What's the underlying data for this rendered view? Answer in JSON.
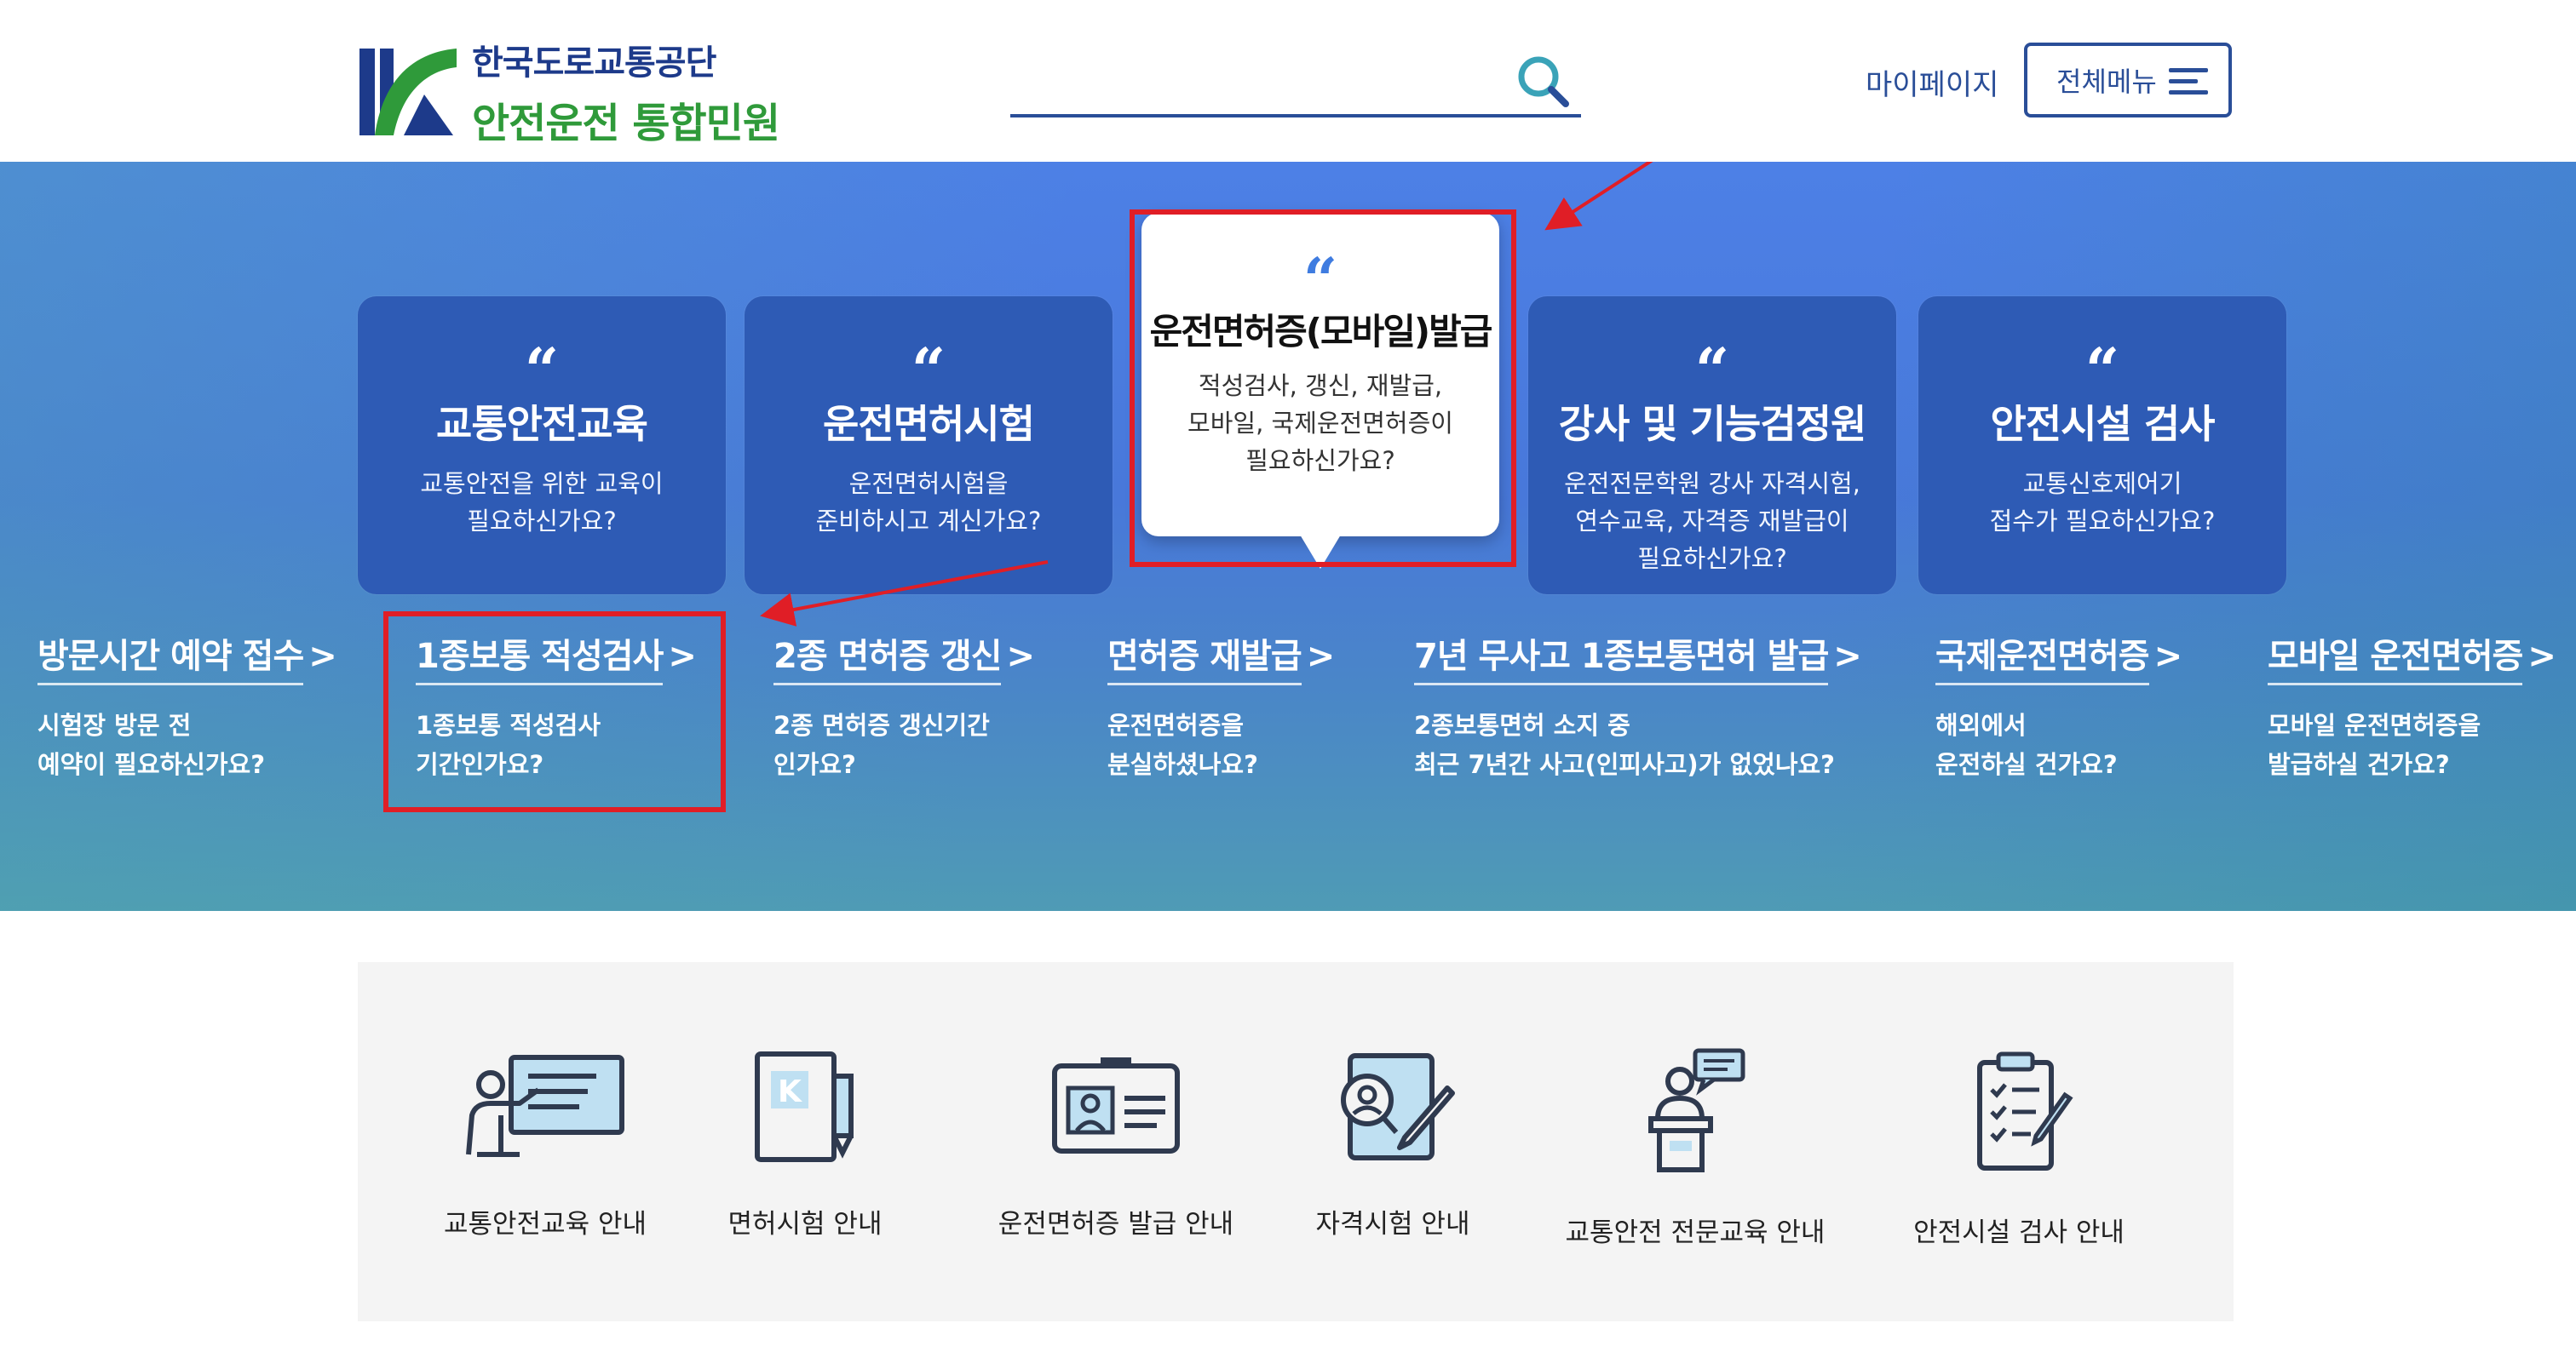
{
  "header": {
    "logo_top": "한국도로교통공단",
    "logo_bottom": "안전운전 통합민원",
    "search_placeholder": "",
    "mypage_label": "마이페이지",
    "allmenu_label": "전체메뉴"
  },
  "cards": [
    {
      "quote": "“",
      "title": "교통안전교육",
      "desc": "교통안전을 위한 교육이\n필요하신가요?"
    },
    {
      "quote": "“",
      "title": "운전면허시험",
      "desc": "운전면허시험을\n준비하시고 계신가요?"
    },
    {
      "quote": "“",
      "title": "운전면허증(모바일)발급",
      "desc": "적성검사, 갱신, 재발급,\n모바일, 국제운전면허증이\n필요하신가요?"
    },
    {
      "quote": "“",
      "title": "강사 및 기능검정원",
      "desc": "운전전문학원 강사 자격시험,\n연수교육, 자격증 재발급이\n필요하신가요?"
    },
    {
      "quote": "“",
      "title": "안전시설 검사",
      "desc": "교통신호제어기\n접수가 필요하신가요?"
    }
  ],
  "links": [
    {
      "title": "방문시간 예약 접수",
      "chevron": ">",
      "desc": "시험장 방문 전\n예약이 필요하신가요?"
    },
    {
      "title": "1종보통 적성검사",
      "chevron": ">",
      "desc": "1종보통 적성검사\n기간인가요?"
    },
    {
      "title": "2종 면허증 갱신",
      "chevron": ">",
      "desc": "2종 면허증 갱신기간\n인가요?"
    },
    {
      "title": "면허증 재발급",
      "chevron": ">",
      "desc": "운전면허증을\n분실하셨나요?"
    },
    {
      "title": "7년 무사고 1종보통면허 발급",
      "chevron": ">",
      "desc": "2종보통면허 소지 중\n최근 7년간 사고(인피사고)가 없었나요?"
    },
    {
      "title": "국제운전면허증",
      "chevron": ">",
      "desc": "해외에서\n운전하실 건가요?"
    },
    {
      "title": "모바일 운전면허증",
      "chevron": ">",
      "desc": "모바일 운전면허증을\n발급하실 건가요?"
    }
  ],
  "quick_menu": [
    {
      "label": "교통안전교육 안내",
      "icon": "presentation-icon"
    },
    {
      "label": "면허시험 안내",
      "icon": "license-book-icon"
    },
    {
      "label": "운전면허증 발급 안내",
      "icon": "id-card-icon"
    },
    {
      "label": "자격시험 안내",
      "icon": "certificate-exam-icon"
    },
    {
      "label": "교통안전 전문교육 안내",
      "icon": "lecturer-podium-icon"
    },
    {
      "label": "안전시설 검사 안내",
      "icon": "checklist-icon"
    }
  ],
  "colors": {
    "brand_blue": "#2a4e98",
    "brand_green": "#2f9a3a",
    "hero_blue": "#4d80e6",
    "card_blue": "#2e5bb5",
    "highlight_red": "#e01e26"
  }
}
